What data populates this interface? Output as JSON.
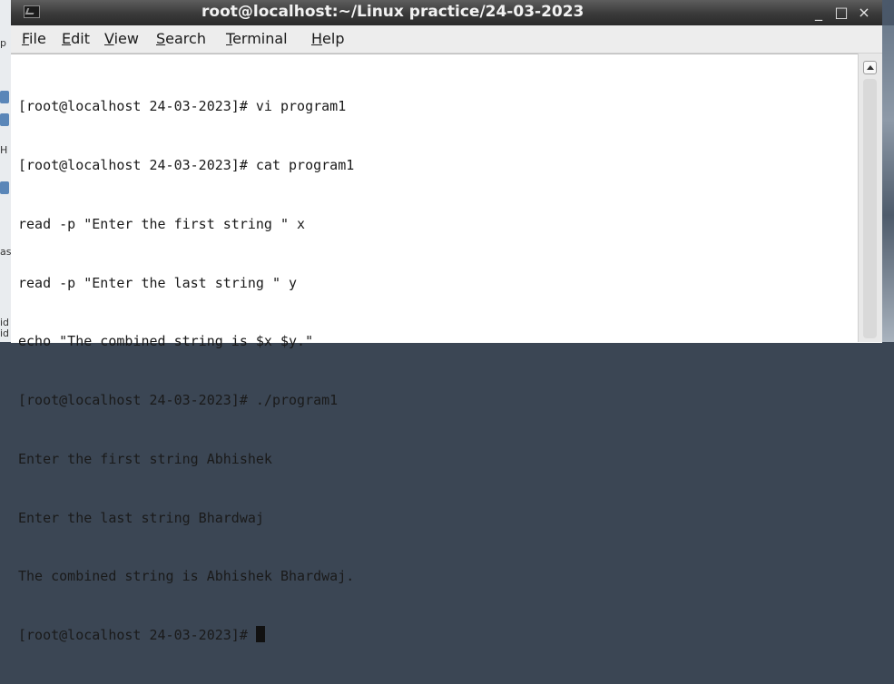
{
  "window": {
    "title": "root@localhost:~/Linux practice/24-03-2023",
    "minimize_glyph": "_",
    "maximize_glyph": "□",
    "close_glyph": "×"
  },
  "menubar": {
    "items": [
      {
        "label": "File"
      },
      {
        "label": "Edit"
      },
      {
        "label": "View"
      },
      {
        "label": "Search"
      },
      {
        "label": "Terminal"
      },
      {
        "label": "Help"
      }
    ]
  },
  "terminal": {
    "lines": [
      "[root@localhost 24-03-2023]# vi program1",
      "[root@localhost 24-03-2023]# cat program1",
      "read -p \"Enter the first string \" x",
      "read -p \"Enter the last string \" y",
      "echo \"The combined string is $x $y.\"",
      "[root@localhost 24-03-2023]# ./program1",
      "Enter the first string Abhishek",
      "Enter the last string Bhardwaj",
      "The combined string is Abhishek Bhardwaj.",
      "[root@localhost 24-03-2023]# "
    ]
  },
  "desktop": {
    "fragments": [
      "p",
      "H",
      "as",
      "id",
      "id"
    ]
  }
}
